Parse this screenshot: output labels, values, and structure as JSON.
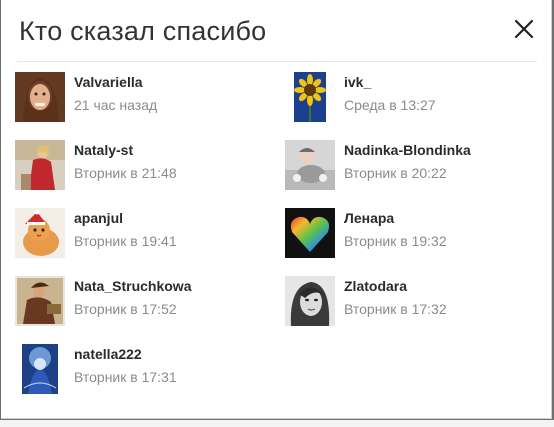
{
  "dialog": {
    "title": "Кто сказал спасибо",
    "close_icon": "close-icon"
  },
  "users": [
    {
      "name": "Valvariella",
      "time": "21 час назад",
      "avatar": "woman-portrait-avatar"
    },
    {
      "name": "ivk_",
      "time": "Среда в 13:27",
      "avatar": "sunflower-avatar"
    },
    {
      "name": "Nataly-st",
      "time": "Вторник в 21:48",
      "avatar": "red-dress-avatar"
    },
    {
      "name": "Nadinka-Blondinka",
      "time": "Вторник в 20:22",
      "avatar": "baby-avatar"
    },
    {
      "name": "apanjul",
      "time": "Вторник в 19:41",
      "avatar": "cat-santa-avatar"
    },
    {
      "name": "Ленара",
      "time": "Вторник в 19:32",
      "avatar": "rainbow-heart-avatar"
    },
    {
      "name": "Nata_Struchkowa",
      "time": "Вторник в 17:52",
      "avatar": "painting-avatar"
    },
    {
      "name": "Zlatodara",
      "time": "Вторник в 17:32",
      "avatar": "sketch-portrait-avatar"
    },
    {
      "name": "natella222",
      "time": "Вторник в 17:31",
      "avatar": "fantasy-blue-avatar"
    }
  ],
  "colors": {
    "title": "#333333",
    "username": "#2b2b2b",
    "timestamp": "#8b8b8b",
    "overlay": "#6f6f6f"
  }
}
